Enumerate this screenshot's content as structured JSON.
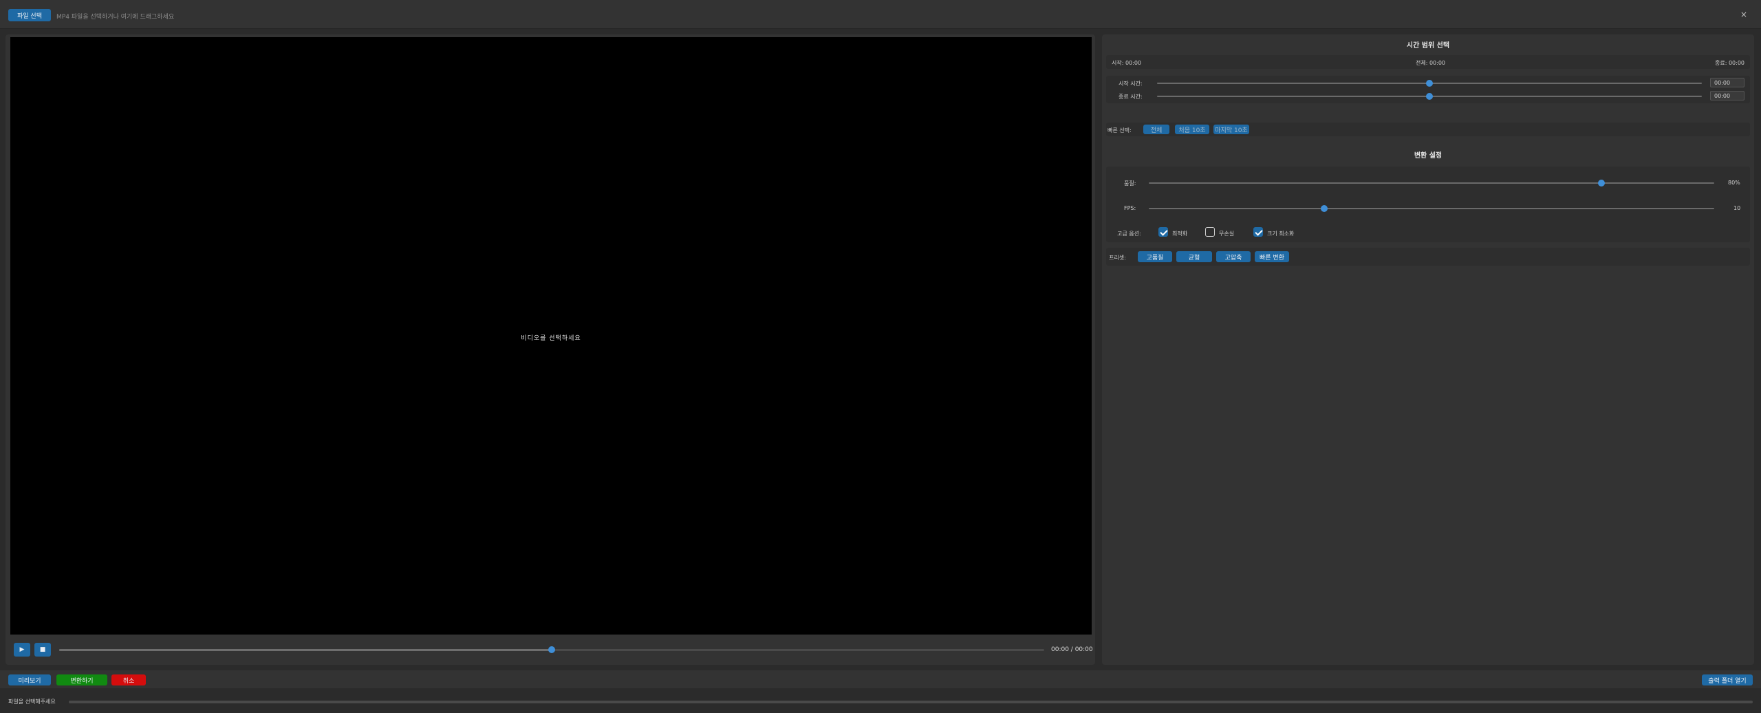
{
  "topbar": {
    "file_button": "파일 선택",
    "hint": "MP4 파일을 선택하거나 여기에 드래그하세요",
    "close": "×"
  },
  "video": {
    "message": "비디오를 선택하세요",
    "controls": {
      "play_icon": "▶",
      "stop_icon": "■",
      "seek_position": 0.5,
      "time": "00:00 / 00:00"
    }
  },
  "time_range": {
    "title": "시간 범위 선택",
    "start_info": "시작: 00:00",
    "total_info": "전체: 00:00",
    "end_info": "종료: 00:00",
    "start_label": "시작 시간:",
    "start_value": "00:00",
    "start_slider": 0.5,
    "end_label": "종료 시간:",
    "end_value": "00:00",
    "end_slider": 0.5,
    "quick_label": "빠른 선택:",
    "quick_buttons": [
      "전체",
      "처음 10초",
      "마지막 10초"
    ]
  },
  "convert": {
    "title": "변환 설정",
    "quality_label": "품질:",
    "quality_value": "80%",
    "quality_level": 0.8,
    "fps_label": "FPS:",
    "fps_value": "10",
    "fps_level": 0.31,
    "options_label": "고급 옵션:",
    "options": [
      {
        "label": "최적화",
        "checked": true
      },
      {
        "label": "무손실",
        "checked": false
      },
      {
        "label": "크기 최소화",
        "checked": true
      }
    ],
    "preset_label": "프리셋:",
    "presets": [
      "고품질",
      "균형",
      "고압축",
      "빠른 변환"
    ]
  },
  "bottom": {
    "preview": "미리보기",
    "convert": "변환하기",
    "cancel": "취소",
    "open_folder": "출력 폴더 열기"
  },
  "status": {
    "text": "파일을 선택해주세요",
    "progress": 0
  },
  "colors": {
    "accent": "#1f6aa5",
    "convert": "#118a11",
    "cancel": "#d40d0d"
  }
}
